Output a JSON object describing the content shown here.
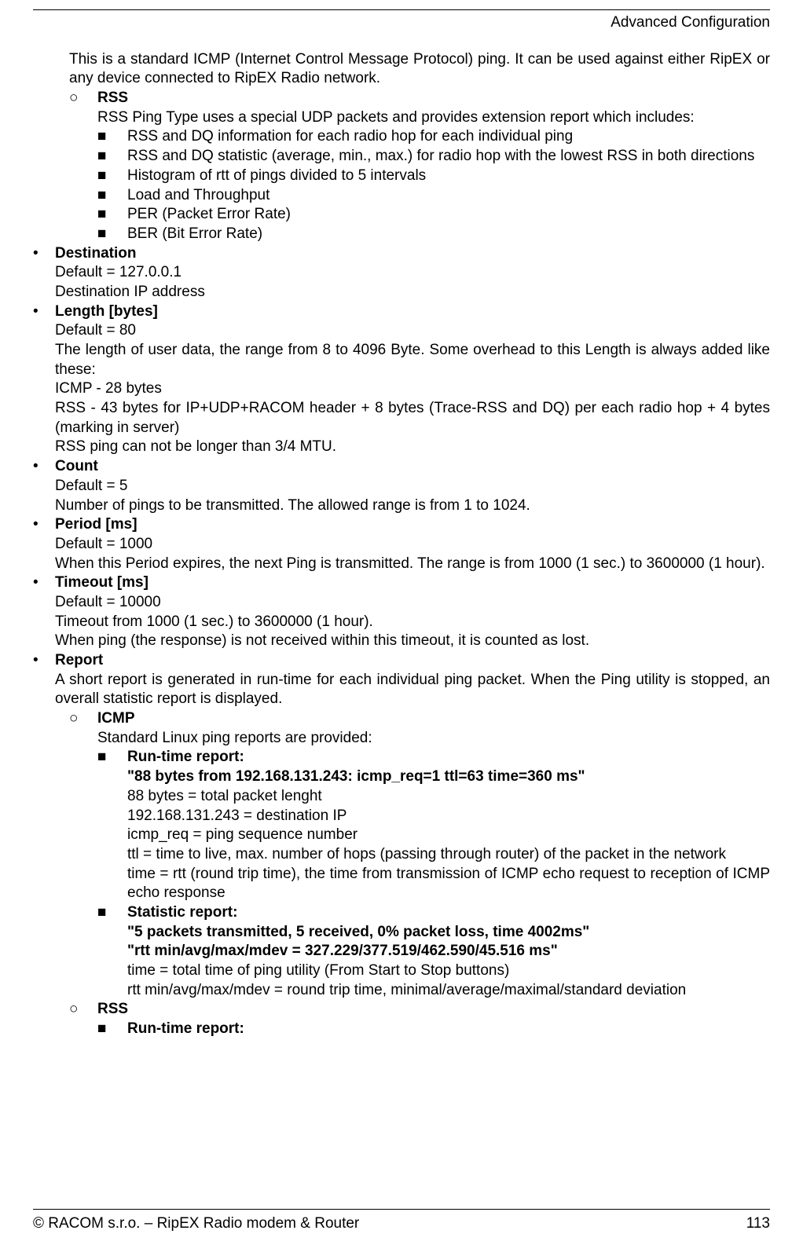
{
  "header": {
    "section": "Advanced Configuration"
  },
  "p_icmp_intro": "This is a standard ICMP (Internet Control Message Protocol) ping. It can be used against either RipEX or any device connected to RipEX Radio network.",
  "rss": {
    "label": "RSS",
    "intro": "RSS Ping Type uses a special UDP packets and provides extension report which includes:",
    "items": [
      "RSS and DQ information for each radio hop for each individual ping",
      "RSS and DQ statistic (average, min., max.) for radio hop with the lowest RSS in both directions",
      "Histogram of rtt of pings divided to 5 intervals",
      "Load and Throughput",
      "PER (Packet Error Rate)",
      "BER (Bit Error Rate)"
    ]
  },
  "destination": {
    "label": "Destination",
    "default": "Default = 127.0.0.1",
    "desc": "Destination IP address"
  },
  "length": {
    "label": "Length [bytes]",
    "default": "Default = 80",
    "desc1": "The length of user data, the range from 8 to 4096 Byte. Some overhead to this Length is always added like these:",
    "icmp": "ICMP - 28 bytes",
    "rssline": "RSS - 43 bytes for IP+UDP+RACOM header + 8 bytes (Trace-RSS and DQ) per each radio hop + 4 bytes (marking in server)",
    "note": "RSS ping can not be longer than 3/4 MTU."
  },
  "count": {
    "label": "Count",
    "default": "Default = 5",
    "desc": "Number of pings to be transmitted. The allowed range is from 1 to 1024."
  },
  "period": {
    "label": "Period [ms]",
    "default": "Default = 1000",
    "desc": "When this Period expires, the next Ping is transmitted. The range is from 1000 (1 sec.) to 3600000 (1 hour)."
  },
  "timeout": {
    "label": "Timeout [ms]",
    "default": "Default = 10000",
    "l1": "Timeout from 1000 (1 sec.) to 3600000 (1 hour).",
    "l2": "When ping (the response) is not received within this timeout, it is counted as lost."
  },
  "report": {
    "label": "Report",
    "intro": "A short report is generated in run-time for each individual ping packet. When the Ping utility is stopped, an overall statistic report is displayed.",
    "icmp": {
      "label": "ICMP",
      "line": "Standard Linux ping reports are provided:",
      "runtime": {
        "label": "Run-time report:",
        "quote": "\"88 bytes from 192.168.131.243: icmp_req=1 ttl=63 time=360 ms\"",
        "a": "88 bytes = total packet lenght",
        "b": "192.168.131.243 = destination IP",
        "c": "icmp_req = ping sequence number",
        "d": "ttl = time to live, max. number of hops (passing through router) of the packet in the network",
        "e": "time = rtt (round trip time), the time from transmission of ICMP echo request to reception of ICMP echo response"
      },
      "stat": {
        "label": "Statistic report:",
        "q1": "\"5 packets transmitted, 5 received, 0% packet loss, time 4002ms\"",
        "q2": "\"rtt min/avg/max/mdev = 327.229/377.519/462.590/45.516 ms\"",
        "a": "time = total time of ping utility (From Start to Stop buttons)",
        "b": "rtt min/avg/max/mdev = round trip time, minimal/average/maximal/standard deviation"
      }
    },
    "rss2": {
      "label": "RSS",
      "runtime_label": "Run-time report:"
    }
  },
  "footer": {
    "left": "© RACOM s.r.o. – RipEX Radio modem & Router",
    "right": "113"
  }
}
